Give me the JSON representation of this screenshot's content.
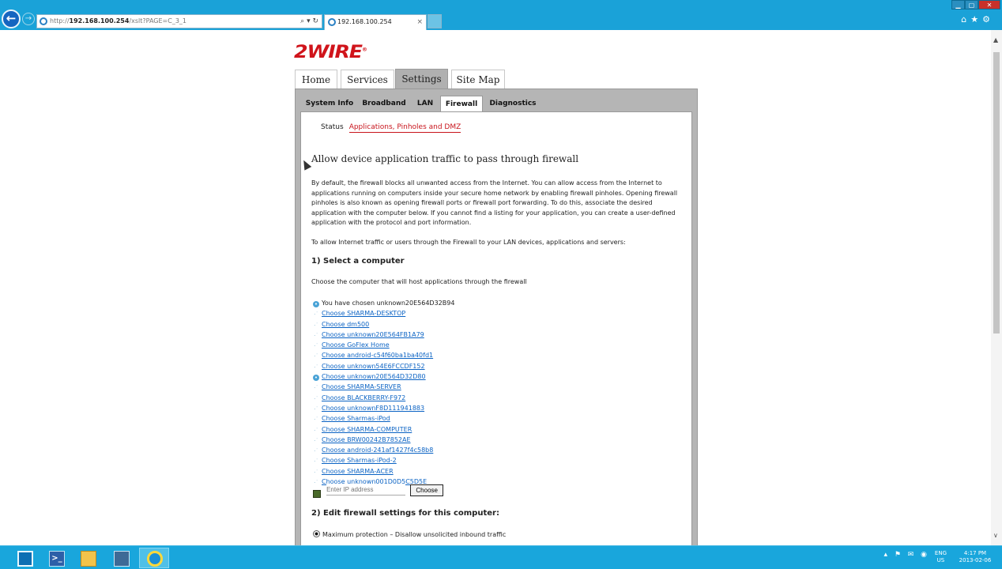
{
  "browser": {
    "address_prefix": "http://",
    "address_host": "192.168.100.254",
    "address_path": "/xslt?PAGE=C_3_1",
    "address_icons": "⌕ ▾ ↻",
    "tab_title": "192.168.100.254",
    "tab_close": "×",
    "toolbar_icons": "⌂★⚙",
    "window_controls": {
      "min": "▁",
      "max": "▢",
      "close": "✕"
    }
  },
  "logo_text": "2WIRE",
  "logo_mark": "®",
  "main_tabs": [
    "Home",
    "Services",
    "Settings",
    "Site Map"
  ],
  "sub_tabs": [
    "System Info",
    "Broadband",
    "LAN",
    "Firewall",
    "Diagnostics"
  ],
  "subnav": {
    "status": "Status",
    "active": "Applications, Pinholes and DMZ"
  },
  "heading": "Allow device application traffic to pass through firewall",
  "intro": "By default, the firewall blocks all unwanted access from the Internet. You can allow access from the Internet to applications running on computers inside your secure home network by enabling firewall pinholes. Opening firewall pinholes is also known as opening firewall ports or firewall port forwarding. To do this, associate the desired application with the computer below. If you cannot find a listing for your application, you can create a user-defined application with the protocol and port information.",
  "intro2": "To allow Internet traffic or users through the Firewall to your LAN devices, applications and servers:",
  "section1": {
    "title": "1) Select a computer",
    "desc": "Choose the computer that will host applications through the firewall"
  },
  "computers": [
    {
      "label": "You have chosen unknown20E564D32B94",
      "link": false,
      "icon": "dot"
    },
    {
      "label": "Choose SHARMA-DESKTOP",
      "link": true,
      "icon": "wifi"
    },
    {
      "label": "Choose dm500",
      "link": true,
      "icon": "wifi"
    },
    {
      "label": "Choose unknown20E564FB1A79",
      "link": true,
      "icon": "wifi"
    },
    {
      "label": "Choose GoFlex Home",
      "link": true,
      "icon": "wifi"
    },
    {
      "label": "Choose android-c54f60ba1ba40fd1",
      "link": true,
      "icon": "wifi"
    },
    {
      "label": "Choose unknown54E6FCCDF152",
      "link": true,
      "icon": "wifi"
    },
    {
      "label": "Choose unknown20E564D32D80",
      "link": true,
      "icon": "dot"
    },
    {
      "label": "Choose SHARMA-SERVER",
      "link": true,
      "icon": "wifi"
    },
    {
      "label": "Choose BLACKBERRY-F972",
      "link": true,
      "icon": "wifi"
    },
    {
      "label": "Choose unknownF8D111941883",
      "link": true,
      "icon": "wifi"
    },
    {
      "label": "Choose Sharmas-iPod",
      "link": true,
      "icon": "wifi"
    },
    {
      "label": "Choose SHARMA-COMPUTER",
      "link": true,
      "icon": "wifi"
    },
    {
      "label": "Choose BRW00242B7852AE",
      "link": true,
      "icon": "wifi"
    },
    {
      "label": "Choose android-241af1427f4c58b8",
      "link": true,
      "icon": "wifi"
    },
    {
      "label": "Choose Sharmas-iPod-2",
      "link": true,
      "icon": "wifi"
    },
    {
      "label": "Choose SHARMA-ACER",
      "link": true,
      "icon": "wifi"
    },
    {
      "label": "Choose unknown001D0D5C5D5E",
      "link": true,
      "icon": "wifi"
    }
  ],
  "ip_entry": {
    "placeholder": "Enter IP address",
    "button": "Choose"
  },
  "section2": {
    "title": "2) Edit firewall settings for this computer:"
  },
  "protection_option": "Maximum protection – Disallow unsolicited inbound traffic",
  "scrollbar": {
    "up": "▲",
    "down": "∨"
  },
  "taskbar": {
    "ps_glyph": ">_",
    "tray_icons": "▴ ⚑ ✉ ◉",
    "lang_1": "ENG",
    "lang_2": "US",
    "time": "4:17 PM",
    "date": "2013-02-06"
  }
}
